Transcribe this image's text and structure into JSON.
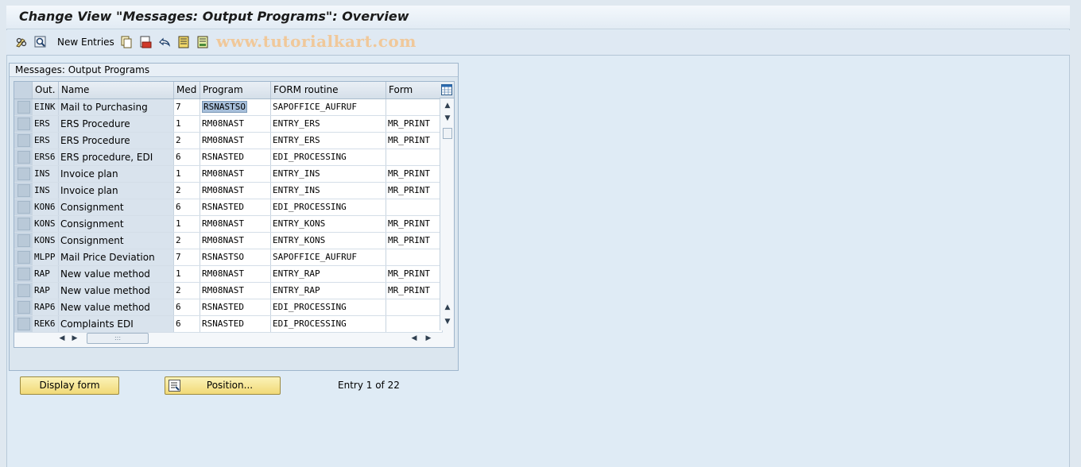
{
  "window": {
    "title": "Change View \"Messages: Output Programs\": Overview"
  },
  "toolbar": {
    "icons": [
      "edit-glasses-icon",
      "find-icon",
      "copy-icon",
      "delete-icon",
      "undo-icon",
      "select-all-icon",
      "deselect-all-icon"
    ],
    "new_entries_label": "New Entries",
    "watermark": "www.tutorialkart.com"
  },
  "group": {
    "title": "Messages: Output Programs"
  },
  "table": {
    "columns": [
      "Out.",
      "Name",
      "Med",
      "Program",
      "FORM routine",
      "Form"
    ],
    "rows": [
      {
        "out": "EINK",
        "name": "Mail to Purchasing",
        "med": "7",
        "program": "RSNASTSO",
        "form_routine": "SAPOFFICE_AUFRUF",
        "form": ""
      },
      {
        "out": "ERS",
        "name": "ERS Procedure",
        "med": "1",
        "program": "RM08NAST",
        "form_routine": "ENTRY_ERS",
        "form": "MR_PRINT"
      },
      {
        "out": "ERS",
        "name": "ERS Procedure",
        "med": "2",
        "program": "RM08NAST",
        "form_routine": "ENTRY_ERS",
        "form": "MR_PRINT"
      },
      {
        "out": "ERS6",
        "name": "ERS procedure, EDI",
        "med": "6",
        "program": "RSNASTED",
        "form_routine": "EDI_PROCESSING",
        "form": ""
      },
      {
        "out": "INS",
        "name": "Invoice plan",
        "med": "1",
        "program": "RM08NAST",
        "form_routine": "ENTRY_INS",
        "form": "MR_PRINT"
      },
      {
        "out": "INS",
        "name": "Invoice plan",
        "med": "2",
        "program": "RM08NAST",
        "form_routine": "ENTRY_INS",
        "form": "MR_PRINT"
      },
      {
        "out": "KON6",
        "name": "Consignment",
        "med": "6",
        "program": "RSNASTED",
        "form_routine": "EDI_PROCESSING",
        "form": ""
      },
      {
        "out": "KONS",
        "name": "Consignment",
        "med": "1",
        "program": "RM08NAST",
        "form_routine": "ENTRY_KONS",
        "form": "MR_PRINT"
      },
      {
        "out": "KONS",
        "name": "Consignment",
        "med": "2",
        "program": "RM08NAST",
        "form_routine": "ENTRY_KONS",
        "form": "MR_PRINT"
      },
      {
        "out": "MLPP",
        "name": "Mail Price Deviation",
        "med": "7",
        "program": "RSNASTSO",
        "form_routine": "SAPOFFICE_AUFRUF",
        "form": ""
      },
      {
        "out": "RAP",
        "name": "New value method",
        "med": "1",
        "program": "RM08NAST",
        "form_routine": "ENTRY_RAP",
        "form": "MR_PRINT"
      },
      {
        "out": "RAP",
        "name": "New value method",
        "med": "2",
        "program": "RM08NAST",
        "form_routine": "ENTRY_RAP",
        "form": "MR_PRINT"
      },
      {
        "out": "RAP6",
        "name": "New value method",
        "med": "6",
        "program": "RSNASTED",
        "form_routine": "EDI_PROCESSING",
        "form": ""
      },
      {
        "out": "REK6",
        "name": "Complaints EDI",
        "med": "6",
        "program": "RSNASTED",
        "form_routine": "EDI_PROCESSING",
        "form": ""
      }
    ]
  },
  "buttons": {
    "display_form": "Display form",
    "position": "Position..."
  },
  "status": {
    "entry_text": "Entry 1 of 22"
  },
  "colors": {
    "button_bg": "#f1d977",
    "selection_highlight": "#a7bfda",
    "watermark": "#f0c89a"
  }
}
